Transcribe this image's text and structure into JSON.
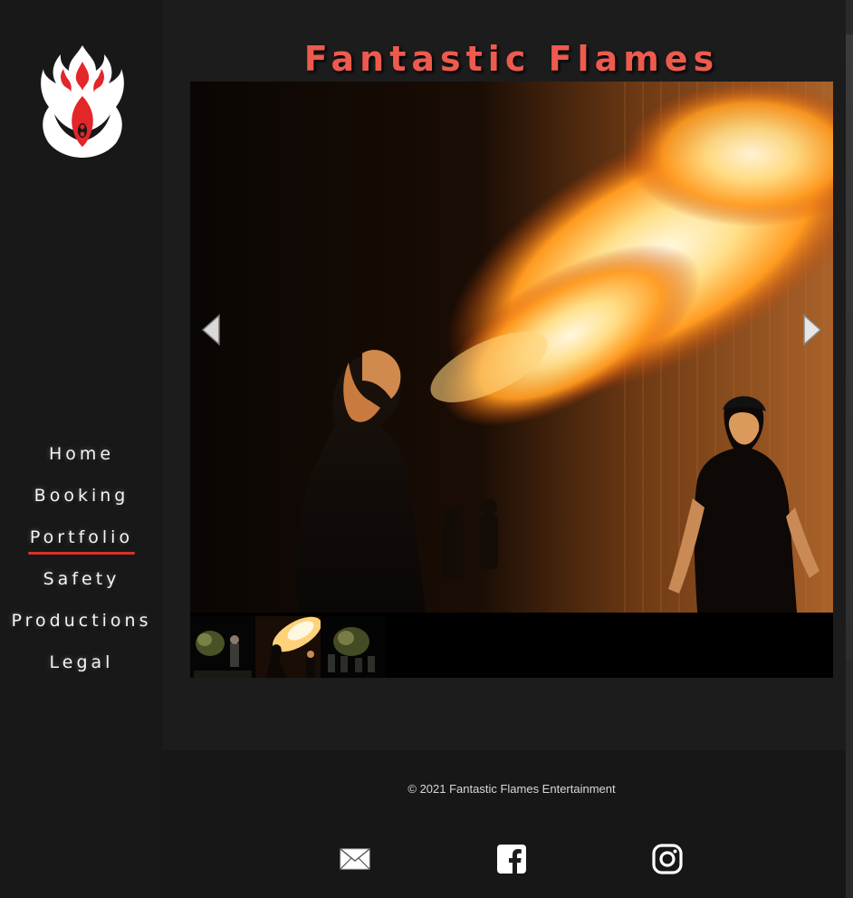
{
  "site": {
    "title": "Fantastic Flames"
  },
  "nav": {
    "items": [
      {
        "label": "Home",
        "active": false
      },
      {
        "label": "Booking",
        "active": false
      },
      {
        "label": "Portfolio",
        "active": true
      },
      {
        "label": "Safety",
        "active": false
      },
      {
        "label": "Productions",
        "active": false
      },
      {
        "label": "Legal",
        "active": false
      }
    ]
  },
  "logo": {
    "icon": "flame-logo-icon"
  },
  "gallery": {
    "prev_icon": "triangle-left-icon",
    "next_icon": "triangle-right-icon",
    "thumbnails": [
      "performers-smoke",
      "fire-breather",
      "crowd-smoke"
    ]
  },
  "footer": {
    "copyright": "© 2021 Fantastic Flames Entertainment",
    "social": [
      {
        "icon": "email-icon"
      },
      {
        "icon": "facebook-icon"
      },
      {
        "icon": "instagram-icon"
      }
    ]
  },
  "colors": {
    "accent": "#ee5a4e",
    "nav_underline": "#d9332a",
    "background": "#1a1a1a"
  }
}
